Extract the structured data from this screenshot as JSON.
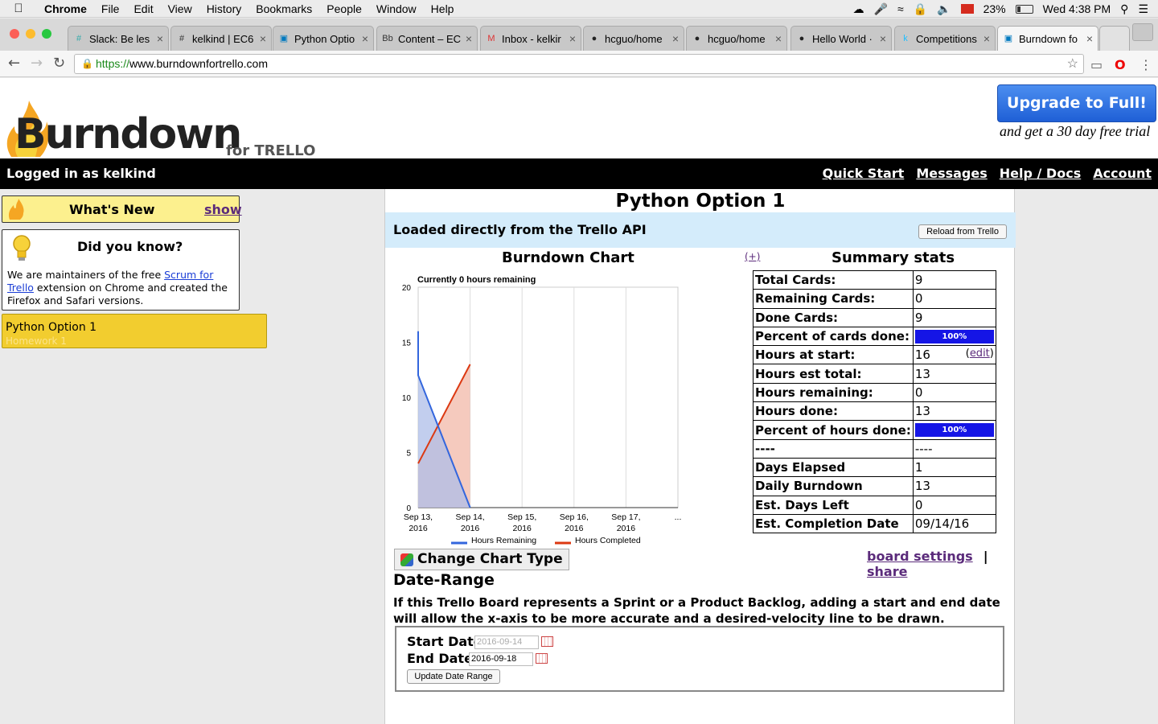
{
  "menubar": {
    "items": [
      "Chrome",
      "File",
      "Edit",
      "View",
      "History",
      "Bookmarks",
      "People",
      "Window",
      "Help"
    ],
    "battery": "23%",
    "clock": "Wed 4:38 PM"
  },
  "tabs": [
    {
      "label": "Slack: Be les",
      "icon": "slack-icon"
    },
    {
      "label": "kelkind | EC6",
      "icon": "hash-icon"
    },
    {
      "label": "Python Optio",
      "icon": "trello-icon"
    },
    {
      "label": "Content – EC",
      "icon": "blackboard-icon"
    },
    {
      "label": "Inbox - kelkir",
      "icon": "gmail-icon"
    },
    {
      "label": "hcguo/home",
      "icon": "github-icon"
    },
    {
      "label": "hcguo/home",
      "icon": "github-icon"
    },
    {
      "label": "Hello World ·",
      "icon": "github-icon"
    },
    {
      "label": "Competitions",
      "icon": "kaggle-icon"
    },
    {
      "label": "Burndown fo",
      "icon": "burndown-icon",
      "active": true
    }
  ],
  "address": {
    "scheme": "https://",
    "host": "www.burndownfortrello.com"
  },
  "header": {
    "logo": "Burndown",
    "logo_sub": "for TRELLO",
    "upgrade": "Upgrade to Full!",
    "trial": "and get a 30 day free trial"
  },
  "topbar": {
    "logged_in": "Logged in as kelkind",
    "links": [
      "Quick Start",
      "Messages",
      "Help / Docs",
      "Account"
    ]
  },
  "sidebar": {
    "whats_new": "What's New",
    "show": "show",
    "dyk_title": "Did you know?",
    "dyk_text_1": "We are maintainers of the free ",
    "dyk_link": "Scrum for Trello",
    "dyk_text_2": " extension on Chrome and created the Firefox and Safari versions.",
    "board": "Python Option 1",
    "board_sub": "Homework 1"
  },
  "main": {
    "title": "Python Option 1",
    "loaded": "Loaded directly from the Trello API",
    "reload": "Reload from Trello",
    "chart_title": "Burndown Chart",
    "plus": "(+)",
    "stats_title": "Summary stats",
    "change_chart": "Change Chart Type",
    "board_settings": "board settings",
    "sep": "|",
    "share": "share",
    "date_range": "Date-Range",
    "date_text": "If this Trello Board represents a Sprint or a Product Backlog, adding a start and end date will allow the x-axis to be more accurate and a desired-velocity line to be drawn.",
    "start_label": "Start Date:",
    "start_value": "2016-09-14",
    "end_label": "End Date:",
    "end_value": "2016-09-18",
    "update": "Update Date Range"
  },
  "stats": [
    {
      "k": "Total Cards:",
      "v": "9"
    },
    {
      "k": "Remaining Cards:",
      "v": "0"
    },
    {
      "k": "Done Cards:",
      "v": "9"
    },
    {
      "k": "Percent of cards done:",
      "v": "100%",
      "bar": true
    },
    {
      "k": "Hours at start:",
      "v": "16",
      "edit": "edit"
    },
    {
      "k": "Hours est total:",
      "v": "13"
    },
    {
      "k": "Hours remaining:",
      "v": "0"
    },
    {
      "k": "Hours done:",
      "v": "13"
    },
    {
      "k": "Percent of hours done:",
      "v": "100%",
      "bar": true
    },
    {
      "k": "----",
      "v": "----"
    },
    {
      "k": "Days Elapsed",
      "v": "1"
    },
    {
      "k": "Daily Burndown",
      "v": "13"
    },
    {
      "k": "Est. Days Left",
      "v": "0"
    },
    {
      "k": "Est. Completion Date",
      "v": "09/14/16"
    }
  ],
  "chart_data": {
    "type": "area",
    "subtitle": "Currently 0 hours remaining",
    "categories": [
      "Sep 13, 2016",
      "Sep 14, 2016",
      "Sep 15, 2016",
      "Sep 16, 2016",
      "Sep 17, 2016",
      "..."
    ],
    "ylim": [
      0,
      20
    ],
    "yticks": [
      0,
      5,
      10,
      15,
      20
    ],
    "grid": true,
    "legend": "bottom",
    "series": [
      {
        "name": "Hours Remaining",
        "color": "#3366dd",
        "fill": "#aebde8",
        "points": [
          [
            0,
            16
          ],
          [
            0,
            12
          ],
          [
            1,
            0
          ]
        ]
      },
      {
        "name": "Hours Completed",
        "color": "#dc3912",
        "fill": "#f2b8a8",
        "points": [
          [
            0,
            4
          ],
          [
            1,
            13
          ]
        ]
      }
    ]
  }
}
